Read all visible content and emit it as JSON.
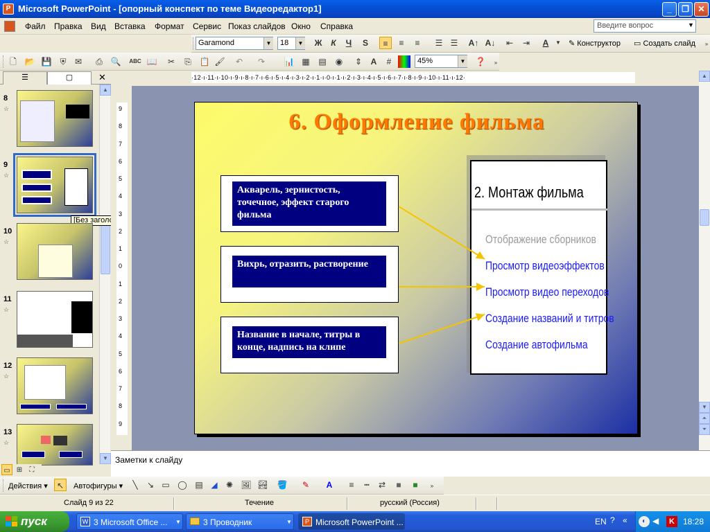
{
  "window": {
    "title": "Microsoft PowerPoint - [опорный конспект по теме Видеоредактор1]"
  },
  "menu": [
    "Файл",
    "Правка",
    "Вид",
    "Вставка",
    "Формат",
    "Сервис",
    "Показ слайдов",
    "Окно",
    "Справка"
  ],
  "ask_placeholder": "Введите вопрос",
  "format_toolbar": {
    "font": "Garamond",
    "size": "18",
    "bold": "Ж",
    "italic": "К",
    "underline": "Ч",
    "shadow": "S",
    "font_color": "A",
    "designer": "Конструктор",
    "new_slide": "Создать слайд"
  },
  "standard_toolbar": {
    "zoom": "45%"
  },
  "ruler": {
    "horizontal": "·12·ı·11·ı·10·ı·9·ı·8·ı·7·ı·6·ı·5·ı·4·ı·3·ı·2·ı·1·ı·0·ı·1·ı·2·ı·3·ı·4·ı·5·ı·6·ı·7·ı·8·ı·9·ı·10·ı·11·ı·12·",
    "vertical": [
      "9",
      "8",
      "7",
      "6",
      "5",
      "4",
      "3",
      "2",
      "1",
      "0",
      "1",
      "2",
      "3",
      "4",
      "5",
      "6",
      "7",
      "8",
      "9"
    ]
  },
  "thumbnails": [
    {
      "num": "8"
    },
    {
      "num": "9"
    },
    {
      "num": "10"
    },
    {
      "num": "11"
    },
    {
      "num": "12"
    },
    {
      "num": "13"
    }
  ],
  "tooltip": "[Без заголовка]",
  "slide": {
    "title": "6. Оформление фильма",
    "boxes": [
      "Акварель, зернистость, точечное, эффект старого фильма",
      "Вихрь, отразить, растворение",
      "Название в начале, титры в конце, надпись на клипе"
    ],
    "panel": {
      "title": "2. Монтаж фильма",
      "items": [
        {
          "text": "Отображение сборников",
          "color": "#9a9a9a"
        },
        {
          "text": "Просмотр видеоэффектов",
          "color": "#1a1aff"
        },
        {
          "text": "Просмотр видео переходов",
          "color": "#1a1aff"
        },
        {
          "text": "Создание названий и титров",
          "color": "#1a1aff"
        },
        {
          "text": "Создание автофильма",
          "color": "#1a1aff"
        }
      ]
    },
    "arrow_color": "#f5c400"
  },
  "notes": "Заметки к слайду",
  "draw_toolbar": {
    "actions": "Действия",
    "autoshapes": "Автофигуры"
  },
  "status": {
    "slide": "Слайд 9 из 22",
    "design": "Течение",
    "language": "русский (Россия)"
  },
  "taskbar": {
    "start": "пуск",
    "buttons": [
      "3 Microsoft Office ...",
      "3 Проводник",
      "Microsoft PowerPoint ..."
    ],
    "lang": "EN",
    "clock": "18:28"
  }
}
